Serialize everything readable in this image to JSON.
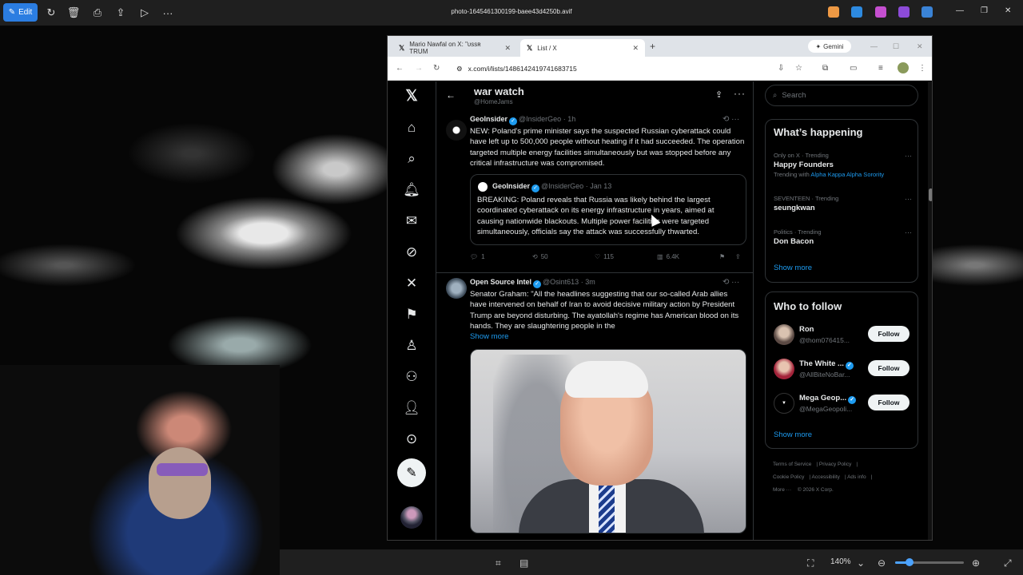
{
  "viewer": {
    "edit_label": "Edit",
    "file_title": "photo-1645461300199-baee43d4250b.avif",
    "zoom": "140%"
  },
  "browser": {
    "tabs": [
      {
        "label": "Mario Nawfal on X: \"ᴜssʀ TRUM"
      },
      {
        "label": "List / X"
      }
    ],
    "gemini_label": "Gemini",
    "url": "x.com/i/lists/1486142419741683715"
  },
  "list": {
    "name": "war watch",
    "owner": "@HomeJams"
  },
  "tweets": [
    {
      "name": "GeoInsider",
      "handle": "@InsiderGeo",
      "time": "· 1h",
      "text": "NEW: Poland's prime minister says the suspected Russian cyberattack could have left up to 500,000 people without heating if it had succeeded. The operation targeted multiple energy facilities simultaneously but was stopped before any critical infrastructure was compromised.",
      "quote": {
        "name": "GeoInsider",
        "handle": "@InsiderGeo",
        "time": "· Jan 13",
        "text": "BREAKING: Poland reveals that Russia was likely behind the largest coordinated cyberattack on its energy infrastructure in years, aimed at causing nationwide blackouts. Multiple power facilities were targeted simultaneously, officials say the attack was successfully thwarted."
      },
      "replies": "1",
      "reposts": "50",
      "likes": "115",
      "views": "6.4K"
    },
    {
      "name": "Open Source Intel",
      "handle": "@Osint613",
      "time": "· 3m",
      "text": "Senator Graham: \"All the headlines suggesting that our so-called Arab allies have intervened on behalf of Iran to avoid decisive military action by President Trump are beyond disturbing. The ayatollah's regime has American blood on its hands. They are slaughtering people in the",
      "show_more": "Show more"
    }
  ],
  "sidebar": {
    "search_placeholder": "Search",
    "happening_title": "What’s happening",
    "trends": [
      {
        "context": "Only on X · Trending",
        "name": "Happy Founders",
        "sub_prefix": "Trending with",
        "sub_link": "Alpha Kappa Alpha Sorority"
      },
      {
        "context": "SEVENTEEN · Trending",
        "name": "seungkwan"
      },
      {
        "context": "Politics · Trending",
        "name": "Don Bacon"
      }
    ],
    "show_more": "Show more",
    "wtf_title": "Who to follow",
    "wtf": [
      {
        "name": "Ron",
        "handle": "@thom076415...",
        "button": "Follow"
      },
      {
        "name": "The White ...",
        "handle": "@AllBiteNoBar...",
        "button": "Follow"
      },
      {
        "name": "Mega Geop...",
        "handle": "@MegaGeopoli...",
        "button": "Follow"
      }
    ],
    "show_more_2": "Show more",
    "footer": {
      "terms": "Terms of Service",
      "privacy": "Privacy Policy",
      "cookie": "Cookie Policy",
      "accessibility": "Accessibility",
      "ads": "Ads info",
      "more": "More ···",
      "copyright": "© 2026 X Corp."
    }
  },
  "colors": {
    "accent": "#1d9bf0",
    "viewer_edit": "#2b7de1"
  }
}
